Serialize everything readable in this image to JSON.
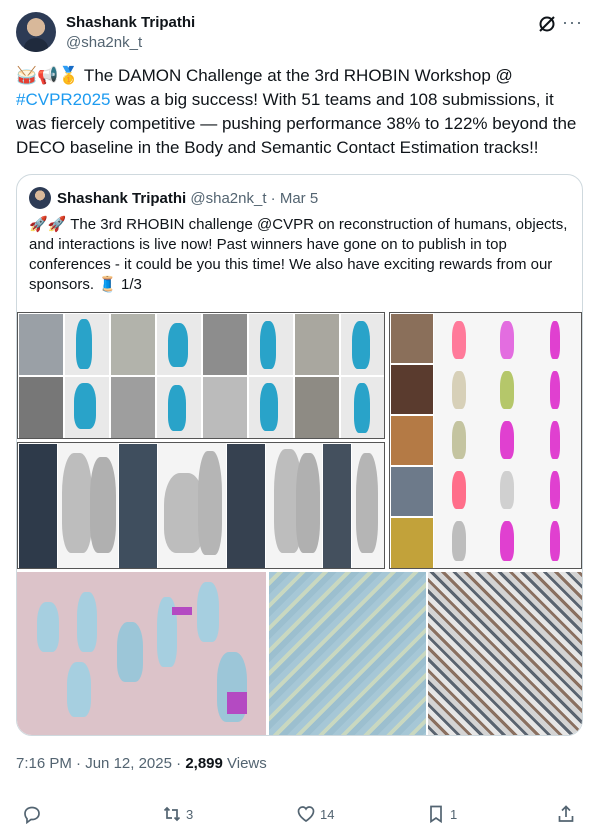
{
  "author": {
    "name": "Shashank Tripathi",
    "handle": "@sha2nk_t"
  },
  "tweet": {
    "emoji": "🥁📢🥇",
    "text_before_link": " The DAMON Challenge at the 3rd RHOBIN Workshop @ ",
    "hashtag": "#CVPR2025",
    "text_after_link": " was a big success! With 51 teams and 108 submissions, it was fiercely competitive — pushing performance 38% to 122% beyond the DECO baseline in the Body and Semantic Contact Estimation tracks!!"
  },
  "quote": {
    "name": "Shashank Tripathi",
    "handle": "@sha2nk_t",
    "separator": " · ",
    "date": "Mar 5",
    "emoji": "🚀🚀",
    "text": " The 3rd RHOBIN challenge @CVPR on reconstruction of humans, objects, and interactions is live now! Past winners have gone on to publish in top conferences - it could be you this time! We also have exciting rewards from our sponsors. 🧵 1/3"
  },
  "meta": {
    "time": "7:16 PM",
    "separator": " · ",
    "date": "Jun 12, 2025",
    "views_count": "2,899",
    "views_label": " Views"
  },
  "actions": {
    "replies": "",
    "reposts": "3",
    "likes": "14",
    "bookmarks": "1"
  },
  "colors": {
    "link": "#1d9bf0",
    "secondary_text": "#536471",
    "border": "#cfd9de",
    "mesh_blue": "#29a3c9",
    "mesh_gray": "#bdbdbd",
    "scene_pink": "#dcc3c9",
    "scene_blue": "#a6c7d6"
  }
}
